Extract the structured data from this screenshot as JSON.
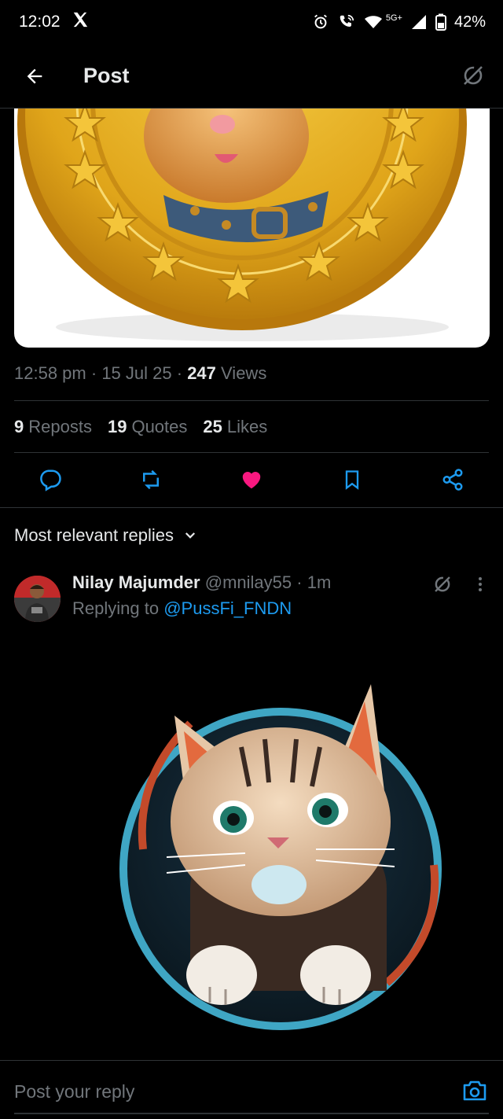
{
  "status_bar": {
    "time": "12:02",
    "network": "5G+",
    "battery": "42%"
  },
  "header": {
    "title": "Post"
  },
  "post": {
    "time": "12:58 pm",
    "date": "15 Jul 25",
    "views_count": "247",
    "views_label": "Views",
    "stats": [
      {
        "count": "9",
        "label": "Reposts"
      },
      {
        "count": "19",
        "label": "Quotes"
      },
      {
        "count": "25",
        "label": "Likes"
      }
    ],
    "liked": true,
    "like_color": "#f91880"
  },
  "replies": {
    "sort_label": "Most relevant replies",
    "items": [
      {
        "name": "Nilay Majumder",
        "handle": "@mnilay55",
        "age": "1m",
        "replying_prefix": "Replying to",
        "replying_handle": "@PussFi_FNDN"
      }
    ]
  },
  "compose": {
    "placeholder": "Post your reply"
  },
  "colors": {
    "accent": "#1d9bf0",
    "background": "#000000",
    "muted": "#71767b"
  },
  "icons": [
    "x-logo-icon",
    "alarm-icon",
    "wifi-call-icon",
    "wifi-icon",
    "signal-icon",
    "battery-icon",
    "back-arrow-icon",
    "grok-icon",
    "reply-icon",
    "repost-icon",
    "heart-icon",
    "bookmark-icon",
    "share-icon",
    "chevron-down-icon",
    "more-vert-icon",
    "camera-icon"
  ]
}
